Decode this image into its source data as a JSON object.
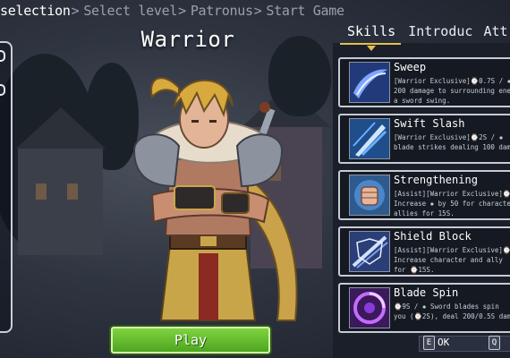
{
  "breadcrumb": [
    {
      "label": "selection",
      "current": true
    },
    {
      "label": "Select level",
      "current": false
    },
    {
      "label": "Patronus",
      "current": false
    },
    {
      "label": "Start Game",
      "current": false
    }
  ],
  "breadcrumb_separator": ">",
  "character": {
    "name": "Warrior"
  },
  "play_button": {
    "label": "Play"
  },
  "tabs": [
    {
      "label": "Skills",
      "active": true
    },
    {
      "label": "Introduc",
      "active": false
    },
    {
      "label": "Att",
      "active": false
    }
  ],
  "skills": [
    {
      "name": "Sweep",
      "desc_lines": [
        "[Warrior Exclusive]⌚0.7S / ✹",
        "200 damage to surrounding ene",
        "a sword swing."
      ],
      "icon": "sweep-icon"
    },
    {
      "name": "Swift Slash",
      "desc_lines": [
        "[Warrior Exclusive]⌚2S / ✹",
        "blade strikes dealing 100 dam"
      ],
      "icon": "swift-slash-icon"
    },
    {
      "name": "Strengthening",
      "desc_lines": [
        "[Assist][Warrior Exclusive]⌚",
        "Increase ✹ by 50 for characte",
        "allies for 15S."
      ],
      "icon": "fist-icon"
    },
    {
      "name": "Shield Block",
      "desc_lines": [
        "[Assist][Warrior Exclusive]⌚",
        "Increase character and ally",
        "for ⌚15S."
      ],
      "icon": "shield-block-icon"
    },
    {
      "name": "Blade Spin",
      "desc_lines": [
        "⌚9S / ✹ Sword blades spin",
        "you (⌚2S), deal 200/0.5S dama"
      ],
      "icon": "blade-spin-icon"
    }
  ],
  "hints": [
    {
      "key": "E",
      "label": "OK"
    },
    {
      "key": "Q",
      "label": ""
    }
  ],
  "colors": {
    "accent": "#e2c04a",
    "play_green": "#62bd2c",
    "card_border": "#c5cad4"
  }
}
